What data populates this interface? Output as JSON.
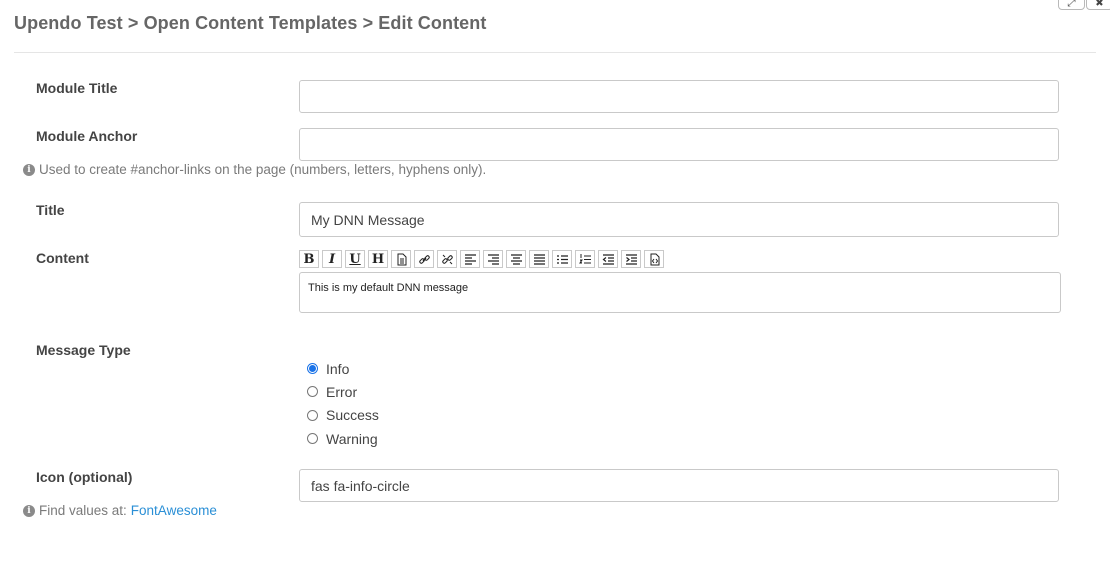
{
  "window_controls": {
    "expand_icon": "expand-icon",
    "close_icon": "close-icon"
  },
  "breadcrumb": "Upendo Test > Open Content Templates > Edit Content",
  "fields": {
    "module_title": {
      "label": "Module Title",
      "value": ""
    },
    "module_anchor": {
      "label": "Module Anchor",
      "value": "",
      "help": "Used to create #anchor-links on the page (numbers, letters, hyphens only)."
    },
    "title": {
      "label": "Title",
      "value": "My DNN Message"
    },
    "content": {
      "label": "Content",
      "value": "This is my default DNN message"
    },
    "message_type": {
      "label": "Message Type",
      "options": [
        "Info",
        "Error",
        "Success",
        "Warning"
      ],
      "selected": "Info"
    },
    "icon": {
      "label": "Icon (optional)",
      "value": "fas fa-info-circle",
      "help": "Find values at:",
      "link": "FontAwesome"
    }
  },
  "toolbar": [
    "bold",
    "italic",
    "underline",
    "heading",
    "paragraph",
    "link",
    "unlink",
    "align-left",
    "align-right",
    "align-center",
    "align-justify",
    "bullet-list",
    "numbered-list",
    "outdent",
    "indent",
    "source"
  ]
}
